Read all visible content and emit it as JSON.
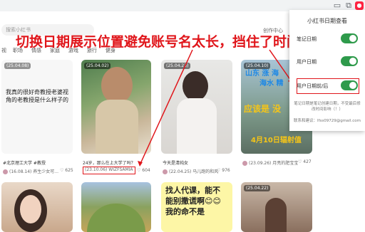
{
  "annotation": "切换日期展示位置避免账号名太长，挡住了时间",
  "search": {
    "placeholder": "搜索小红书"
  },
  "header": {
    "creator": "创作中心"
  },
  "categories": [
    "视",
    "职场",
    "情感",
    "家庭",
    "游戏",
    "旅行",
    "健身"
  ],
  "cards": [
    {
      "date": "(25.04.08)",
      "text": "我真的很好奇教授老婆视角的老教授是什么样子的",
      "tag": "#北京理工大学 #教授",
      "author": "(16.08.14) 养生少女可...",
      "likes": "625"
    },
    {
      "date": "(25.04.02)",
      "text": "24岁，那么在上大学了吗？",
      "author": "(23.10.06) WIZFSAMIA",
      "likes": "604"
    },
    {
      "date": "(25.04.23)",
      "text": "今天是清纯女",
      "author": "(22.04.25) 马儿跑的和风",
      "likes": "976"
    },
    {
      "date": "(25.04.10)",
      "overlay": [
        "山东 涨 海",
        "海水 精",
        "应该是 没",
        "4月10日辐射值"
      ],
      "author": "(23.09.26) 月亮的肥宝宝",
      "likes": "427"
    },
    {
      "text": "找人代课，能不能别撒谎啊😊😊 我的命不是"
    },
    {
      "date": "(25.04.22)"
    }
  ],
  "popup": {
    "title": "小红书日期查看",
    "toggles": [
      {
        "label": "笔记日期",
        "on": true
      },
      {
        "label": "用户日期",
        "on": true
      },
      {
        "label": "用户日期前/后",
        "on": true
      }
    ],
    "note_line1": "笔记日期是笔记创建日期，不受最后修改时间影响（！）",
    "note_line2": "联系和建议：lfss09729@gmail.com"
  },
  "colors": {
    "annotation": "#e0161b",
    "toggle_on": "#2e9a4b",
    "brand": "#ff2442"
  }
}
